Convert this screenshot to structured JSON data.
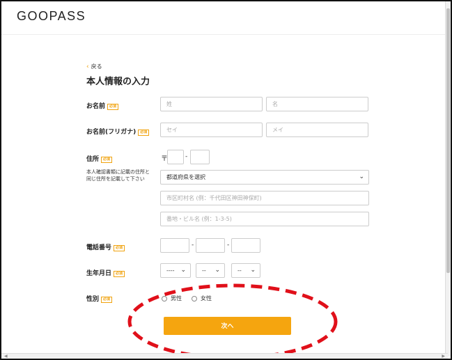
{
  "header": {
    "logo": "GOOPASS"
  },
  "back_label": "戻る",
  "page_title": "本人情報の入力",
  "required_badge": "必須",
  "name": {
    "label": "お名前",
    "last_placeholder": "姓",
    "first_placeholder": "名"
  },
  "kana": {
    "label": "お名前(フリガナ)",
    "last_placeholder": "セイ",
    "first_placeholder": "メイ"
  },
  "address": {
    "label": "住所",
    "note": "本人確認書類に記載の住所と同じ住所を記載して下さい",
    "postal_mark": "〒",
    "prefecture_selected": "都道府県を選択",
    "city_placeholder": "市区町村名 (例：千代田区神田神保町)",
    "street_placeholder": "番地・ビル名 (例：1-3-5)"
  },
  "phone": {
    "label": "電話番号"
  },
  "birthdate": {
    "label": "生年月日",
    "year": "----",
    "month": "--",
    "day": "--"
  },
  "gender": {
    "label": "性別",
    "male": "男性",
    "female": "女性"
  },
  "next_button": "次へ",
  "separator": "-",
  "colors": {
    "accent": "#f5a50f",
    "annotation": "#e0101a"
  }
}
